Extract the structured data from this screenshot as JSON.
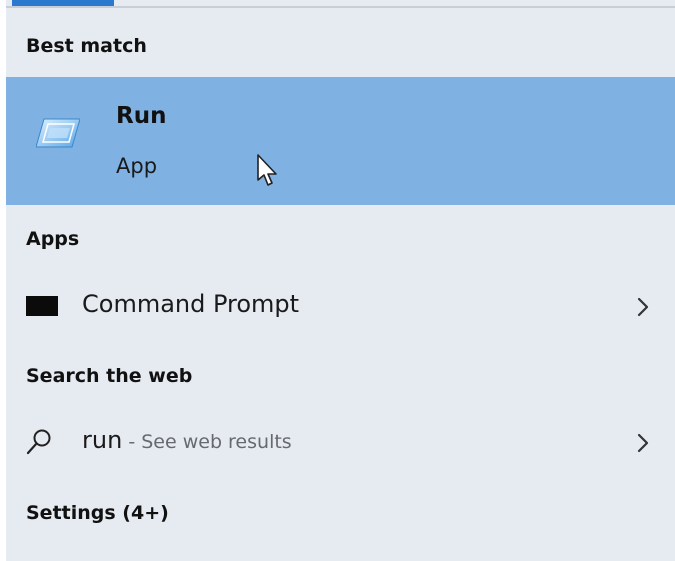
{
  "sections": {
    "best_match": "Best match",
    "apps": "Apps",
    "search_web": "Search the web",
    "settings": "Settings (4+)"
  },
  "best_match_item": {
    "title": "Run",
    "type": "App",
    "icon": "run-icon"
  },
  "apps_items": [
    {
      "label": "Command Prompt",
      "icon": "command-prompt-icon"
    }
  ],
  "web_result": {
    "query": "run",
    "suffix": " - See web results",
    "icon": "search-icon"
  },
  "colors": {
    "panel_bg": "#e6eaf1",
    "highlight": "#7fb1e3",
    "accent": "#2b79cf"
  }
}
